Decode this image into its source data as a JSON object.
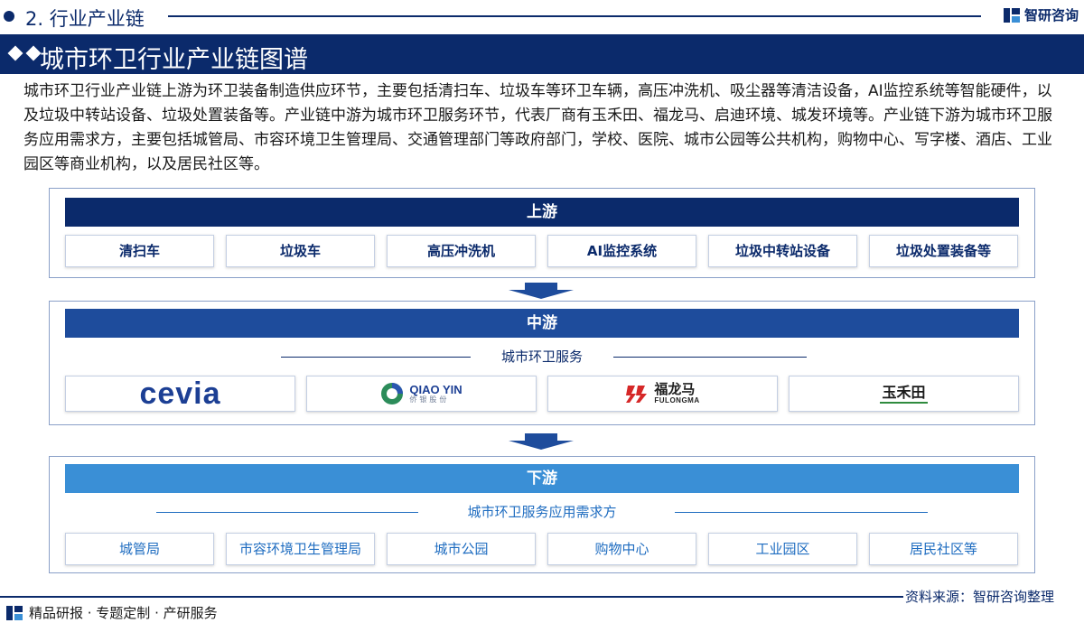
{
  "header": {
    "section_title": "2. 行业产业链",
    "brand_name": "智研咨询",
    "banner_title": "城市环卫行业产业链图谱"
  },
  "intro_text": "城市环卫行业产业链上游为环卫装备制造供应环节，主要包括清扫车、垃圾车等环卫车辆，高压冲洗机、吸尘器等清洁设备，AI监控系统等智能硬件，以及垃圾中转站设备、垃圾处置装备等。产业链中游为城市环卫服务环节，代表厂商有玉禾田、福龙马、启迪环境、城发环境等。产业链下游为城市环卫服务应用需求方，主要包括城管局、市容环境卫生管理局、交通管理部门等政府部门，学校、医院、城市公园等公共机构，购物中心、写字楼、酒店、工业园区等商业机构，以及居民社区等。",
  "upstream": {
    "title": "上游",
    "items": [
      "清扫车",
      "垃圾车",
      "高压冲洗机",
      "AI监控系统",
      "垃圾中转站设备",
      "垃圾处置装备等"
    ]
  },
  "midstream": {
    "title": "中游",
    "subtitle": "城市环卫服务",
    "logos": {
      "cevia": "cevia",
      "qiaoyin_en": "QIAO YIN",
      "qiaoyin_cn": "侨银股份",
      "fulongma_cn": "福龙马",
      "fulongma_en": "FULONGMA",
      "yuhetian": "玉禾田"
    }
  },
  "downstream": {
    "title": "下游",
    "subtitle": "城市环卫服务应用需求方",
    "items": [
      "城管局",
      "市容环境卫生管理局",
      "城市公园",
      "购物中心",
      "工业园区",
      "居民社区等"
    ]
  },
  "footer": {
    "source": "资料来源：智研咨询整理",
    "slogan": "精品研报 · 专题定制 · 产研服务"
  },
  "colors": {
    "navy": "#0b2a6b",
    "mid_blue": "#1e4c9c",
    "light_blue": "#3a8fd6"
  }
}
